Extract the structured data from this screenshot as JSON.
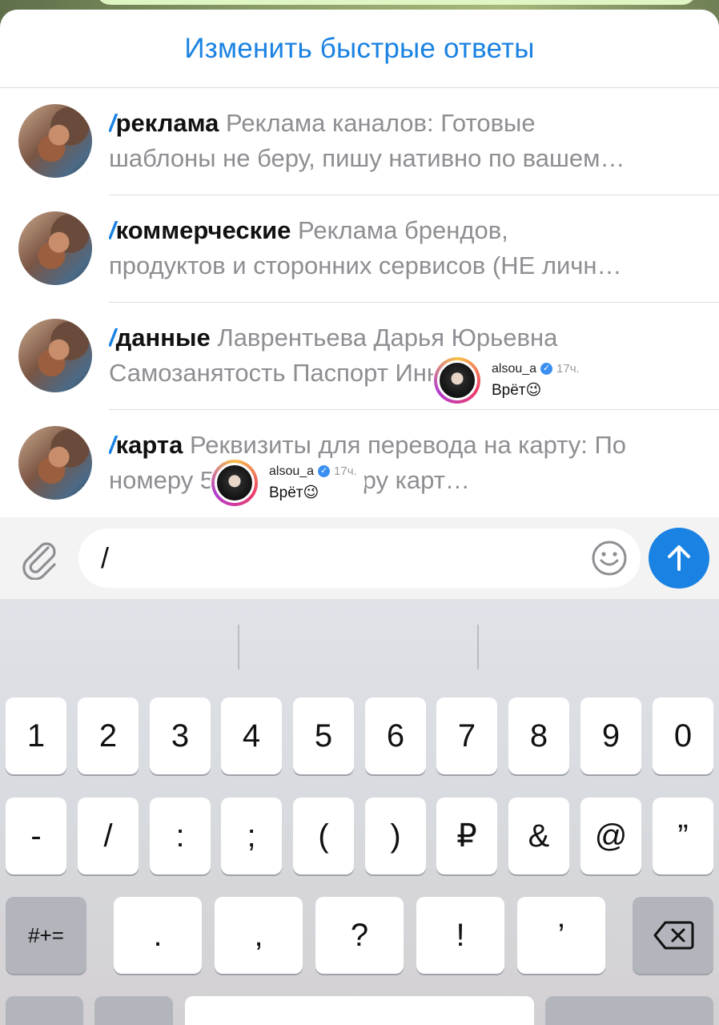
{
  "panel": {
    "header_title": "Изменить быстрые ответы",
    "replies": [
      {
        "slash": "/",
        "name": "реклама",
        "line1": "Реклама каналов:  Готовые",
        "line2": "шаблоны не беру, пишу нативно по вашем…"
      },
      {
        "slash": "/",
        "name": "коммерческие",
        "line1": "Реклама брендов,",
        "line2": "продуктов и сторонних сервисов (НЕ личн…"
      },
      {
        "slash": "/",
        "name": "данные",
        "line1": "Лаврентьева Дарья Юрьевна",
        "line2": "Самозанятость Паспорт                    Инн…"
      },
      {
        "slash": "/",
        "name": "карта",
        "line1": "Реквизиты для перевода на карту: По",
        "line2": "номеру                           5 или по номеру карт…"
      }
    ]
  },
  "story_chips": [
    {
      "username": "alsou_a",
      "time": "17ч.",
      "message": "Врёт😉"
    },
    {
      "username": "alsou_a",
      "time": "17ч.",
      "message": "Врёт😉"
    }
  ],
  "input": {
    "value": "/"
  },
  "icons": {
    "attach": "paperclip-icon",
    "emoji": "smiley-icon",
    "send": "arrow-up-icon",
    "verified": "verified-badge-icon"
  },
  "colors": {
    "accent": "#1a82e2",
    "secondary_text": "#8e8e93"
  },
  "keyboard": {
    "row1": [
      "1",
      "2",
      "3",
      "4",
      "5",
      "6",
      "7",
      "8",
      "9",
      "0"
    ],
    "row2": [
      "-",
      "/",
      ":",
      ";",
      "(",
      ")",
      "₽",
      "&",
      "@",
      "”"
    ],
    "row3_left": "#+=",
    "row3": [
      ".",
      ",",
      "?",
      "!",
      "’"
    ],
    "backspace": "backspace-icon"
  }
}
